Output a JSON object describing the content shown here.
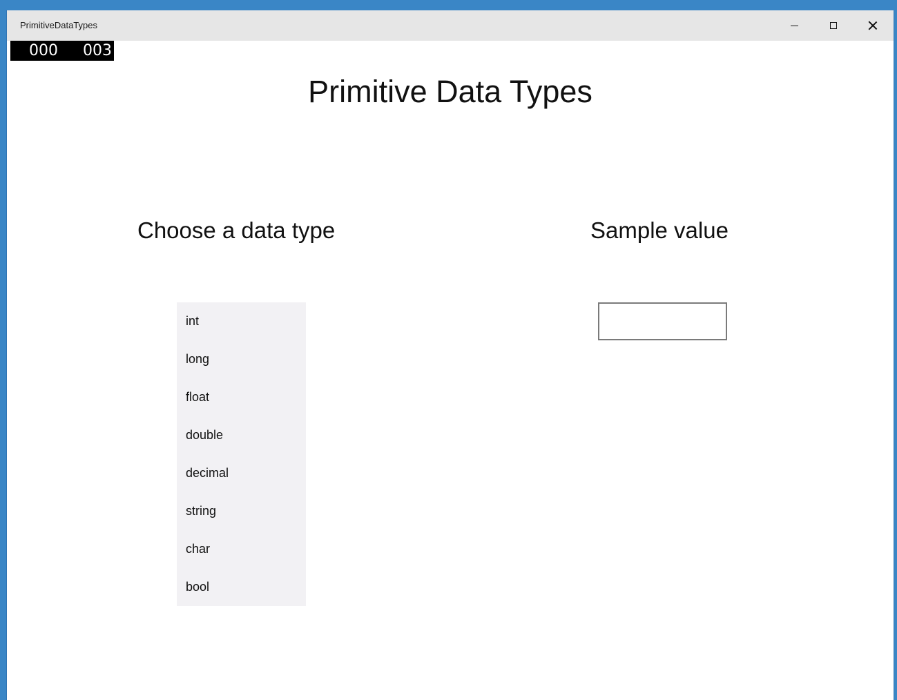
{
  "window": {
    "title": "PrimitiveDataTypes",
    "minimize_icon": "minimize-icon",
    "maximize_icon": "maximize-icon",
    "close_icon": "close-icon"
  },
  "frame_counter": {
    "left": "000",
    "right": "003"
  },
  "main": {
    "title": "Primitive Data Types",
    "choose_header": "Choose a data type",
    "sample_header": "Sample value",
    "data_types": [
      "int",
      "long",
      "float",
      "double",
      "decimal",
      "string",
      "char",
      "bool"
    ],
    "sample_value": ""
  },
  "colors": {
    "desktop_accent": "#3a86c6",
    "titlebar": "#e6e6e6",
    "list_background": "#f2f1f4"
  }
}
